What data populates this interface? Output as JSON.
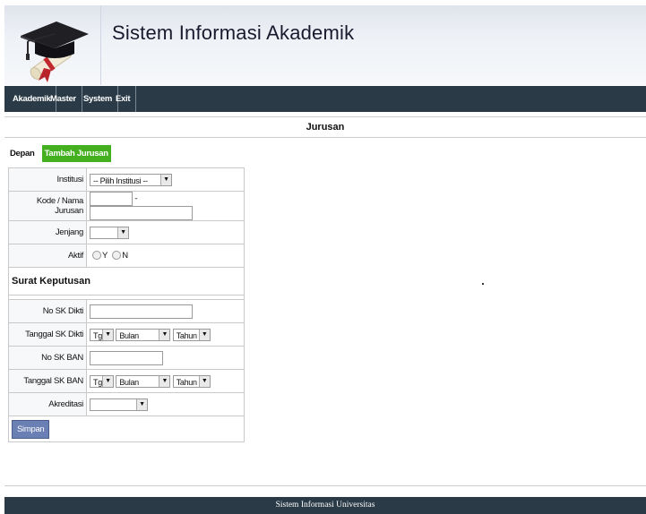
{
  "app": {
    "title": "Sistem Informasi Akademik"
  },
  "nav": {
    "items": [
      "Akademik",
      "Master",
      "System",
      "Exit"
    ]
  },
  "page": {
    "title": "Jurusan"
  },
  "tabs": {
    "depan": "Depan",
    "tambah": "Tambah Jurusan"
  },
  "form": {
    "institusi_label": "Institusi",
    "institusi_value": "-- Pilih Institusi --",
    "kode_nama_label": "Kode / Nama Jurusan",
    "kode_separator": "-",
    "jenjang_label": "Jenjang",
    "aktif_label": "Aktif",
    "aktif_options": [
      "Y",
      "N"
    ],
    "surat_keputusan": "Surat Keputusan",
    "no_sk_dikti_label": "No SK Dikti",
    "tanggal_sk_dikti_label": "Tanggal SK Dikti",
    "no_sk_ban_label": "No SK BAN",
    "tanggal_sk_ban_label": "Tanggal SK BAN",
    "date_parts": {
      "tgl": "Tgl",
      "bulan": "Bulan",
      "tahun": "Tahun"
    },
    "akreditasi_label": "Akreditasi",
    "save_label": "Simpan"
  },
  "footer": {
    "text": "Sistem Informasi Universitas"
  },
  "colors": {
    "navbar": "#2a3a46",
    "active_tab": "#44b020",
    "save_button": "#6a7fb3"
  },
  "icons": {
    "logo": "graduation-cap-diploma-icon",
    "dropdown": "chevron-down-icon"
  }
}
